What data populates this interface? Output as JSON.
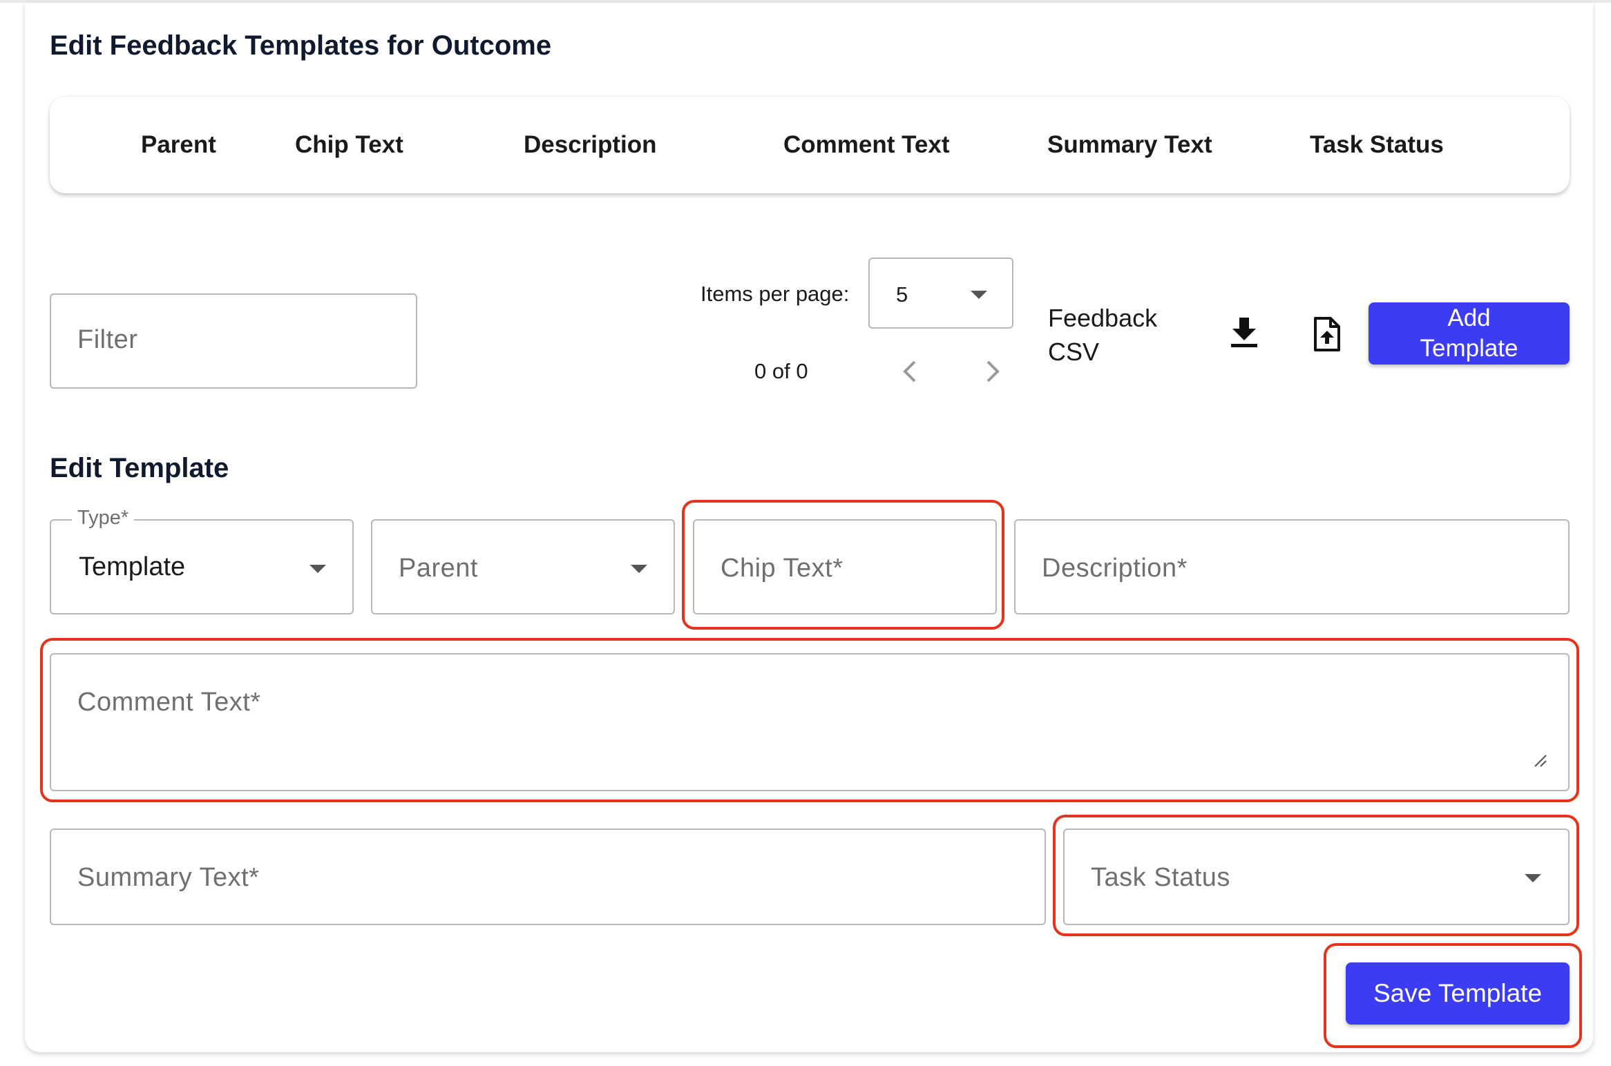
{
  "page": {
    "title": "Edit Feedback Templates for Outcome"
  },
  "table": {
    "columns": [
      "Parent",
      "Chip Text",
      "Description",
      "Comment Text",
      "Summary Text",
      "Task Status"
    ]
  },
  "toolbar": {
    "filter_placeholder": "Filter",
    "items_per_page_label": "Items per page:",
    "items_per_page_value": "5",
    "range_label": "0 of 0",
    "csv_label_line1": "Feedback",
    "csv_label_line2": "CSV",
    "download_icon": "download-icon",
    "upload_icon": "upload-file-icon",
    "add_button_line1": "Add",
    "add_button_line2": "Template"
  },
  "form": {
    "section_title": "Edit Template",
    "type_label": "Type*",
    "type_value": "Template",
    "parent_placeholder": "Parent",
    "chip_text_placeholder": "Chip Text*",
    "description_placeholder": "Description*",
    "comment_text_placeholder": "Comment Text*",
    "summary_text_placeholder": "Summary Text*",
    "task_status_placeholder": "Task Status",
    "save_button": "Save Template"
  },
  "colors": {
    "primary": "#3c3cf5",
    "highlight": "#e6341c",
    "border": "#b7b7b7"
  }
}
